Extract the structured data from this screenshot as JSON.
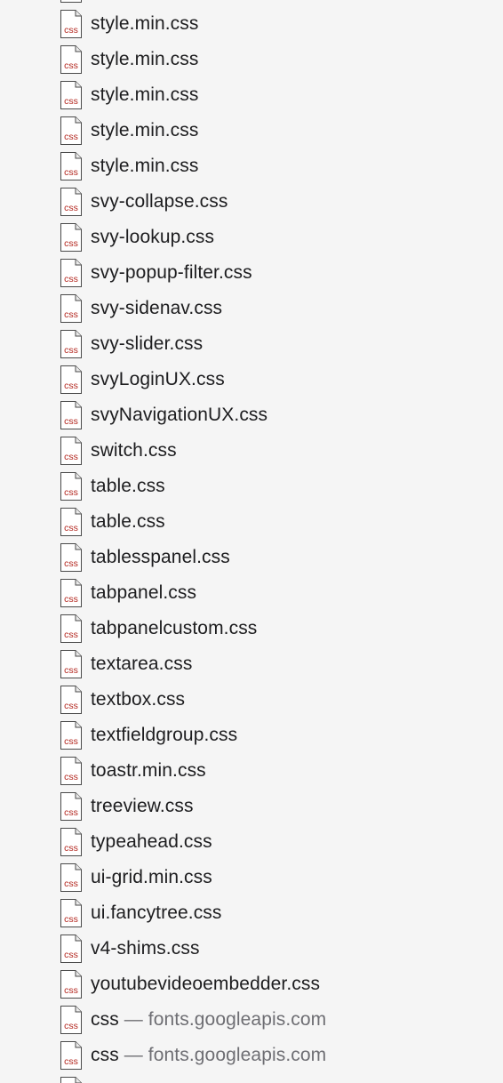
{
  "files": [
    {
      "name": "style.min.css"
    },
    {
      "name": "style.min.css"
    },
    {
      "name": "style.min.css"
    },
    {
      "name": "style.min.css"
    },
    {
      "name": "style.min.css"
    },
    {
      "name": "svy-collapse.css"
    },
    {
      "name": "svy-lookup.css"
    },
    {
      "name": "svy-popup-filter.css"
    },
    {
      "name": "svy-sidenav.css"
    },
    {
      "name": "svy-slider.css"
    },
    {
      "name": "svyLoginUX.css"
    },
    {
      "name": "svyNavigationUX.css"
    },
    {
      "name": "switch.css"
    },
    {
      "name": "table.css"
    },
    {
      "name": "table.css"
    },
    {
      "name": "tablesspanel.css"
    },
    {
      "name": "tabpanel.css"
    },
    {
      "name": "tabpanelcustom.css"
    },
    {
      "name": "textarea.css"
    },
    {
      "name": "textbox.css"
    },
    {
      "name": "textfieldgroup.css"
    },
    {
      "name": "toastr.min.css"
    },
    {
      "name": "treeview.css"
    },
    {
      "name": "typeahead.css"
    },
    {
      "name": "ui-grid.min.css"
    },
    {
      "name": "ui.fancytree.css"
    },
    {
      "name": "v4-shims.css"
    },
    {
      "name": "youtubevideoembedder.css"
    },
    {
      "name": "css",
      "separator": "—",
      "domain": "fonts.googleapis.com"
    },
    {
      "name": "css",
      "separator": "—",
      "domain": "fonts.googleapis.com"
    }
  ],
  "icon": {
    "name": "css-file-icon",
    "label": "css",
    "label_color": "#b3261e"
  }
}
